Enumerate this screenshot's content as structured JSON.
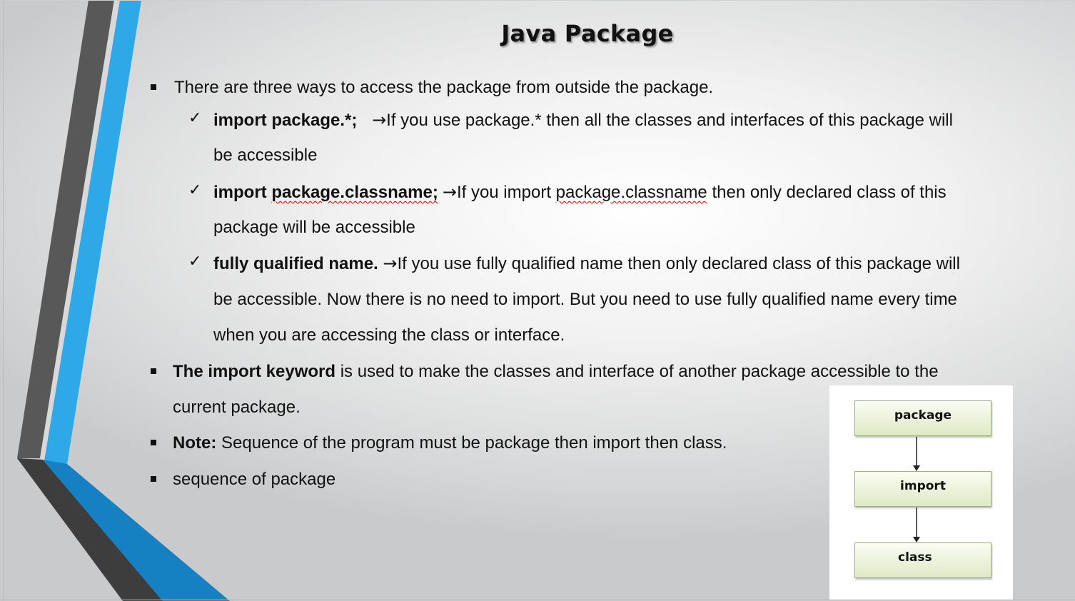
{
  "slide": {
    "title": "Java Package",
    "bullet1": "There are three ways to access the package from outside the package.",
    "sub1": {
      "bold": "import package.*;",
      "arrow": "→",
      "text_line1": "If you use package.* then all the classes and interfaces of this package will",
      "text_line2": "be accessible"
    },
    "sub2": {
      "bold_prefix": "import",
      "bold_underlined": "package.classname;",
      "arrow": "→",
      "text_pre": "If you import",
      "text_underlined": "package.classname",
      "text_post": "then only declared class of this",
      "text_line2": "package will be accessible"
    },
    "sub3": {
      "bold": "fully qualified name.",
      "arrow": "→",
      "text_line1": "If you use fully qualified name then only declared class of this package will",
      "text_line2": "be accessible. Now there is no need to import. But you need to use fully qualified name every time",
      "text_line3": "when you are accessing the class or interface."
    },
    "bullet2": {
      "bold": "The import keyword",
      "text_line1": "is used to make the classes and interface of another package accessible to the",
      "text_line2": "current package."
    },
    "bullet3": {
      "bold": "Note:",
      "text": "Sequence of the program must be package then import then class."
    },
    "bullet4": "sequence of package",
    "check_glyph": "✓"
  },
  "diagram": {
    "boxes": [
      "package",
      "import",
      "class"
    ]
  },
  "colors": {
    "accent_blue": "#2ea8e6",
    "dark_blue": "#1580c2",
    "dark_gray": "#4a4a4a"
  }
}
